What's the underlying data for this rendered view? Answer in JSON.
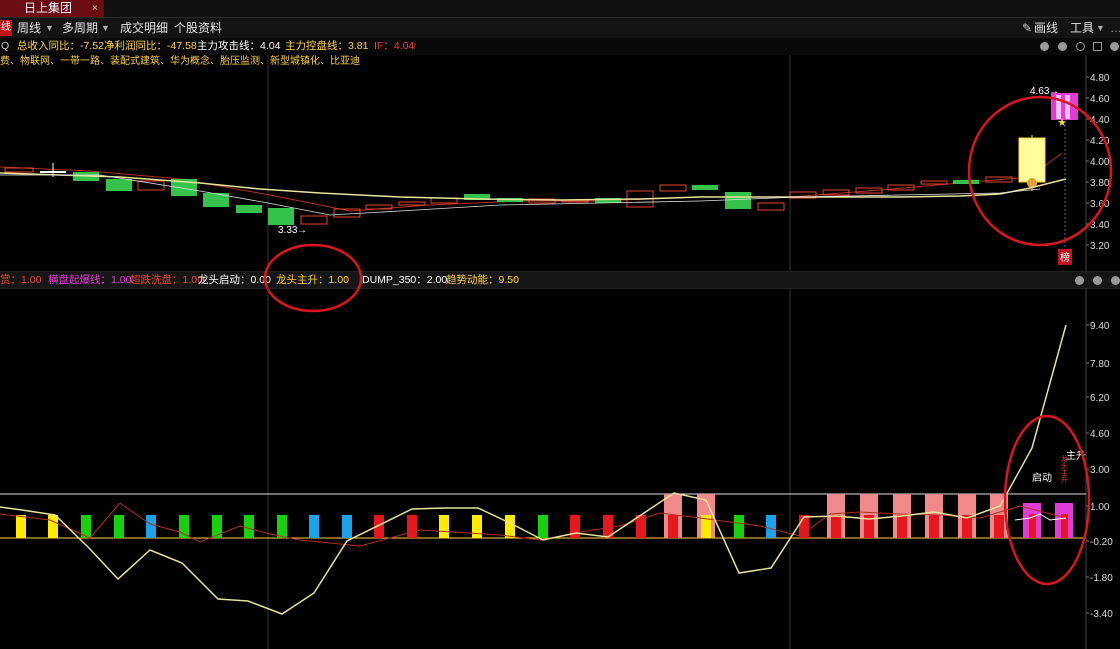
{
  "tab": {
    "title": "日上集团",
    "close": "×"
  },
  "toolbar": {
    "left_tag": "线",
    "period": "周线",
    "multi_period": "多周期",
    "trade_detail": "成交明细",
    "stock_info": "个股资料",
    "draw_line": "画线",
    "tools": "工具",
    "arrow": "▼"
  },
  "infobar": {
    "prefix": "Q",
    "revenue_yoy": "总收入同比：-7.52",
    "profit_yoy": "净利润同比：-47.58",
    "main_attack": "主力攻击线：4.04",
    "main_control": "主力控盘线：3.81",
    "if_val": "IF：4.04",
    "up": "↑"
  },
  "tags": "费、物联网、一带一路、装配式建筑、华为概念、胎压监测、新型城镇化、比亚迪",
  "price_axis": [
    "4.80",
    "4.60",
    "4.40",
    "4.20",
    "4.00",
    "3.80",
    "3.60",
    "3.40",
    "3.20"
  ],
  "price_high_label": "4.63",
  "price_low_label": "3.33",
  "corner_badge": "榜",
  "indicator_bar": {
    "item1": "赏：1.00",
    "item2": "横盘起爆线：1.00",
    "item3": "超跌洗盘：1.00",
    "item4": "龙头启动：0.00",
    "item5": "龙头主升：1.00",
    "item6": "DUMP_350：2.00",
    "item7": "趋势动能：9.50",
    "up": "↑"
  },
  "ind_axis": [
    "9.40",
    "7.80",
    "6.20",
    "4.60",
    "3.00",
    "1.00",
    "-0.20",
    "-1.80",
    "-3.40"
  ],
  "ind_labels": {
    "start": "启动",
    "rise": "主升",
    "rise_vertical": "龙头主升"
  },
  "colors": {
    "up": "#e8452f",
    "down": "#35c24a",
    "bg": "#000000",
    "accent_red": "#d9161e",
    "yellow": "#ffd23f",
    "ma": "#e8e39a"
  }
}
